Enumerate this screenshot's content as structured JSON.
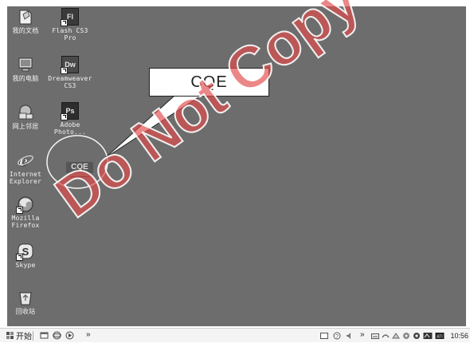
{
  "desktop": {
    "icons": [
      {
        "name": "my-documents-icon",
        "label": "我的文档"
      },
      {
        "name": "flash-cs3-icon",
        "label": "Flash CS3\nPro",
        "badge": "Fl"
      },
      {
        "name": "my-computer-icon",
        "label": "我的电脑"
      },
      {
        "name": "dreamweaver-cs3-icon",
        "label": "Dreamweaver\nCS3",
        "badge": "Dw"
      },
      {
        "name": "network-places-icon",
        "label": "网上邻居"
      },
      {
        "name": "photoshop-icon",
        "label": "Adobe\nPhoto...",
        "badge": "Ps"
      },
      {
        "name": "internet-explorer-icon",
        "label": "Internet\nExplorer"
      },
      {
        "name": "firefox-icon",
        "label": "Mozilla\nFirefox"
      },
      {
        "name": "skype-icon",
        "label": "Skype",
        "badge": "S"
      },
      {
        "name": "recycle-bin-icon",
        "label": "回收站"
      }
    ],
    "cqe_item": "CQE"
  },
  "callout": {
    "text": "CQE"
  },
  "watermark": {
    "text": "Do Not Copy"
  },
  "taskbar": {
    "start_label": "开始",
    "quicklaunch_chevron": "»",
    "tray_chevron": "»",
    "clock": "10:56"
  },
  "colors": {
    "desktop": "#6d6d6d",
    "taskbar": "#f4f4f4",
    "watermark": "#e24c4c"
  }
}
